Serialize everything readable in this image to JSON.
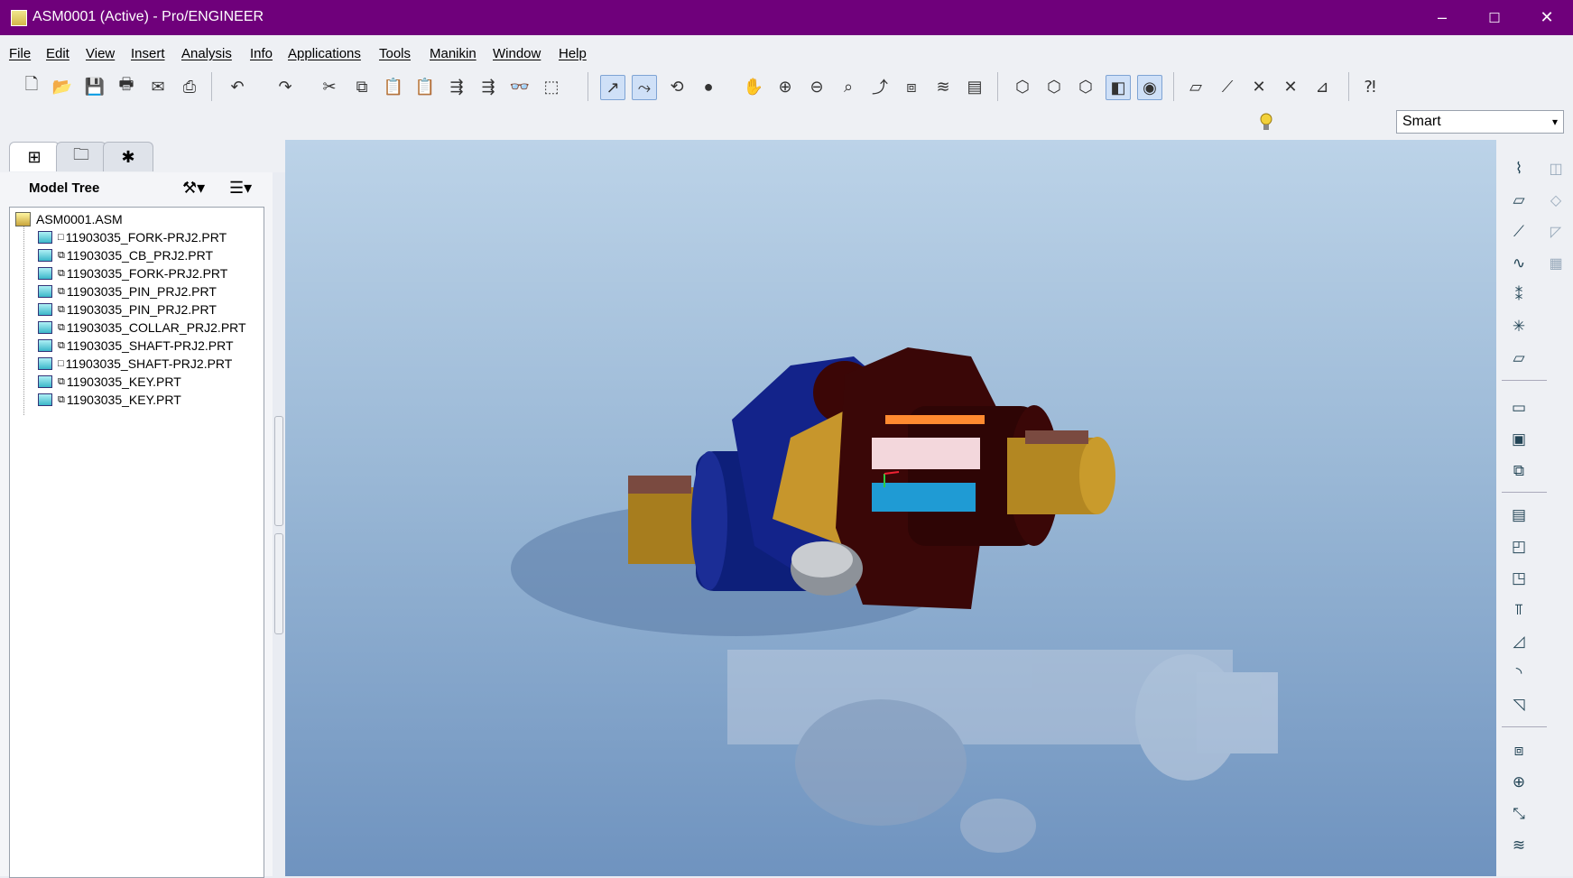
{
  "window": {
    "title": "ASM0001 (Active) - Pro/ENGINEER",
    "minimize": "–",
    "maximize": "☐",
    "close": "✕"
  },
  "menu": [
    "File",
    "Edit",
    "View",
    "Insert",
    "Analysis",
    "Info",
    "Applications",
    "Tools",
    "Manikin",
    "Window",
    "Help"
  ],
  "toolbar": {
    "filter_value": "Smart",
    "filter_arrow": "▾",
    "icons": [
      "new-icon",
      "open-icon",
      "save-icon",
      "print-icon",
      "email-icon",
      "print-preview-icon",
      "undo-icon",
      "redo-icon",
      "cut-icon",
      "copy-icon",
      "paste-icon",
      "paste-special-icon",
      "regenerate-icon",
      "regen-manager-icon",
      "find-icon",
      "select-box-icon",
      "repaint-icon",
      "spin-center-icon",
      "orient-icon",
      "appearance-icon",
      "pan-icon",
      "zoom-in-icon",
      "zoom-out-icon",
      "refit-icon",
      "reorient-icon",
      "saved-views-icon",
      "layers-icon",
      "view-manager-icon",
      "wireframe-icon",
      "hidden-line-icon",
      "no-hidden-icon",
      "shading-icon",
      "enhanced-realism-icon",
      "datum-planes-icon",
      "datum-axes-icon",
      "point-display-icon",
      "csys-display-icon",
      "annotation-display-icon",
      "whats-this-icon"
    ]
  },
  "nav_tabs": [
    "model-tree-tab",
    "folder-browser-tab",
    "favorites-tab"
  ],
  "model_tree": {
    "title": "Model Tree",
    "root": "ASM0001.ASM",
    "items": [
      "11903035_FORK-PRJ2.PRT",
      "11903035_CB_PRJ2.PRT",
      "11903035_FORK-PRJ2.PRT",
      "11903035_PIN_PRJ2.PRT",
      "11903035_PIN_PRJ2.PRT",
      "11903035_COLLAR_PRJ2.PRT",
      "11903035_SHAFT-PRJ2.PRT",
      "11903035_SHAFT-PRJ2.PRT",
      "11903035_KEY.PRT",
      "11903035_KEY.PRT"
    ]
  },
  "right_tools": [
    "sketch-icon",
    "datum-plane-icon",
    "datum-axis-icon",
    "datum-curve-icon",
    "datum-point-icon",
    "datum-csys-icon",
    "analysis-feature-icon",
    "assemble-icon",
    "create-component-icon",
    "package-icon",
    "hole-icon",
    "round-icon",
    "chamfer-icon",
    "draft-icon",
    "pattern-icon",
    "mirror-icon",
    "explode-icon",
    "warp-icon"
  ],
  "colors": {
    "titlebar": "#6f007b",
    "viewport_top": "#bcd3e8",
    "viewport_bottom": "#6f93bf",
    "fork_blue": "#0d1f7a",
    "fork_dark": "#3a0707",
    "shaft_gold": "#c7962c"
  }
}
